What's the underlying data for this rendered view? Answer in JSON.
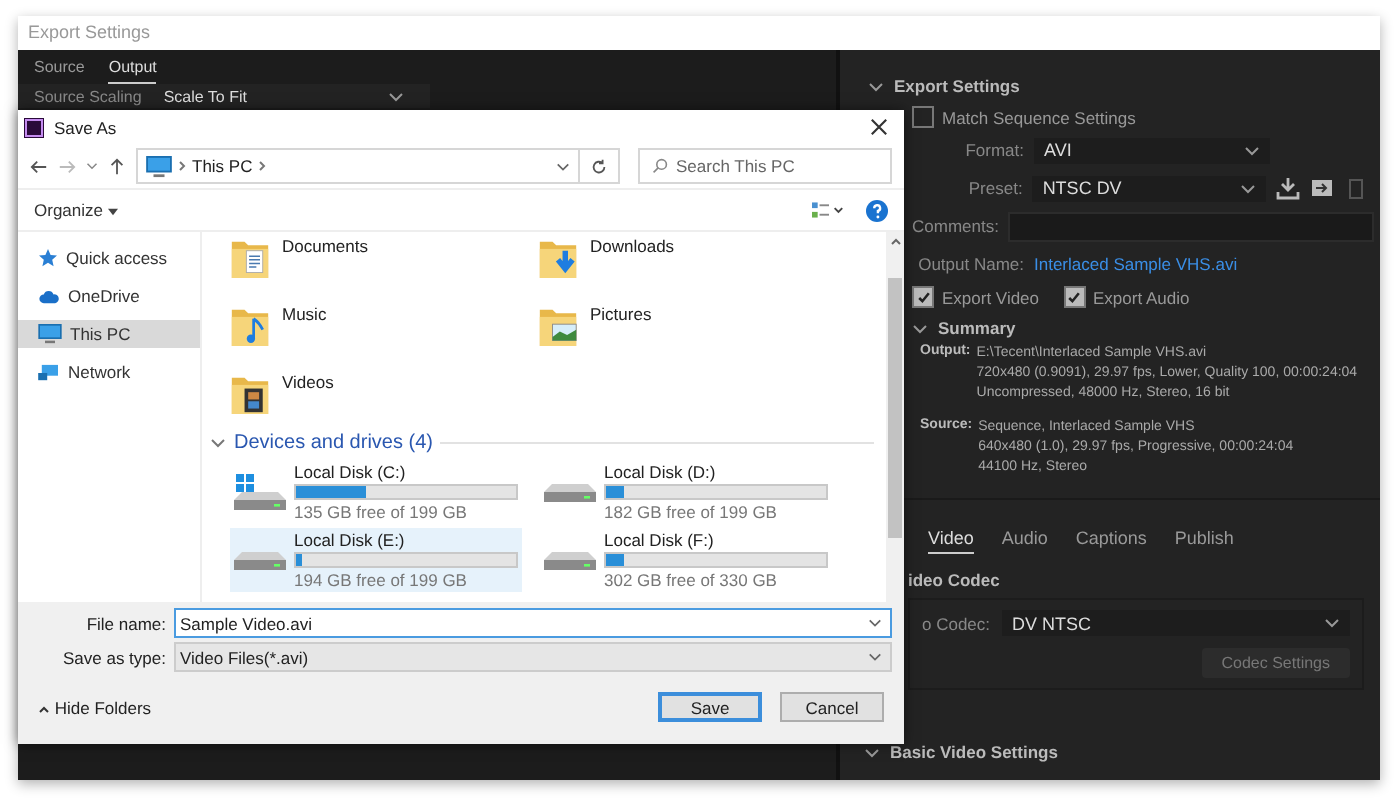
{
  "export_window": {
    "title": "Export Settings",
    "left_tabs": [
      {
        "label": "Source",
        "selected": false
      },
      {
        "label": "Output",
        "selected": true
      }
    ],
    "source_scaling": {
      "label": "Source Scaling",
      "value": "Scale To Fit"
    },
    "settings": {
      "heading": "Export Settings",
      "match_sequence": {
        "label": "Match Sequence Settings",
        "checked": false
      },
      "format": {
        "label": "Format:",
        "value": "AVI"
      },
      "preset": {
        "label": "Preset:",
        "value": "NTSC DV"
      },
      "comments": {
        "label": "Comments:"
      },
      "output_name": {
        "label": "Output Name:",
        "value": "Interlaced Sample VHS.avi"
      },
      "export_checks": [
        {
          "label": "Export Video",
          "checked": true
        },
        {
          "label": "Export Audio",
          "checked": true
        }
      ],
      "summary": {
        "heading": "Summary",
        "entries": [
          {
            "label": "Output:",
            "lines": [
              "E:\\Tecent\\Interlaced Sample VHS.avi",
              "720x480 (0.9091), 29.97 fps, Lower, Quality 100, 00:00:24:04",
              "Uncompressed, 48000 Hz, Stereo, 16 bit"
            ]
          },
          {
            "label": "Source:",
            "lines": [
              "Sequence, Interlaced Sample VHS",
              "640x480 (1.0), 29.97 fps, Progressive, 00:00:24:04",
              "44100 Hz, Stereo"
            ]
          }
        ]
      },
      "tabs": [
        {
          "label": "Video",
          "selected": true
        },
        {
          "label": "Audio",
          "selected": false
        },
        {
          "label": "Captions",
          "selected": false
        },
        {
          "label": "Publish",
          "selected": false
        }
      ],
      "video_codec": {
        "heading": "ideo Codec",
        "label": "o Codec:",
        "value": "DV NTSC",
        "settings_button": {
          "label": "Codec Settings",
          "disabled": true
        }
      },
      "basic_video_heading": "Basic Video Settings"
    }
  },
  "save_dialog": {
    "title": "Save As",
    "address": "This PC",
    "search_placeholder": "Search This PC",
    "organize": "Organize",
    "nav": [
      {
        "label": "Quick access",
        "kind": "star",
        "selected": false
      },
      {
        "label": "OneDrive",
        "kind": "cloud",
        "selected": false
      },
      {
        "label": "This PC",
        "kind": "pc",
        "selected": true
      },
      {
        "label": "Network",
        "kind": "network",
        "selected": false
      }
    ],
    "folders": [
      {
        "name": "Documents",
        "kind": "documents"
      },
      {
        "name": "Downloads",
        "kind": "downloads"
      },
      {
        "name": "Music",
        "kind": "music"
      },
      {
        "name": "Pictures",
        "kind": "pictures"
      },
      {
        "name": "Videos",
        "kind": "videos"
      }
    ],
    "drives_heading": "Devices and drives (4)",
    "drives": [
      {
        "name": "Local Disk (C:)",
        "free": "135 GB free of 199 GB",
        "level": 0.32,
        "kind": "system",
        "selected": false
      },
      {
        "name": "Local Disk (D:)",
        "free": "182 GB free of 199 GB",
        "level": 0.085,
        "kind": "plain",
        "selected": false
      },
      {
        "name": "Local Disk (E:)",
        "free": "194 GB free of 199 GB",
        "level": 0.03,
        "kind": "plain",
        "selected": true
      },
      {
        "name": "Local Disk (F:)",
        "free": "302 GB free of 330 GB",
        "level": 0.085,
        "kind": "plain",
        "selected": false
      }
    ],
    "file_name": {
      "label": "File name:",
      "value": "Sample Video.avi"
    },
    "save_type": {
      "label": "Save as type:",
      "value": "Video Files(*.avi)"
    },
    "hide_folders": "Hide Folders",
    "buttons": [
      {
        "label": "Save",
        "kind": "primary"
      },
      {
        "label": "Cancel",
        "kind": "secondary"
      }
    ]
  }
}
